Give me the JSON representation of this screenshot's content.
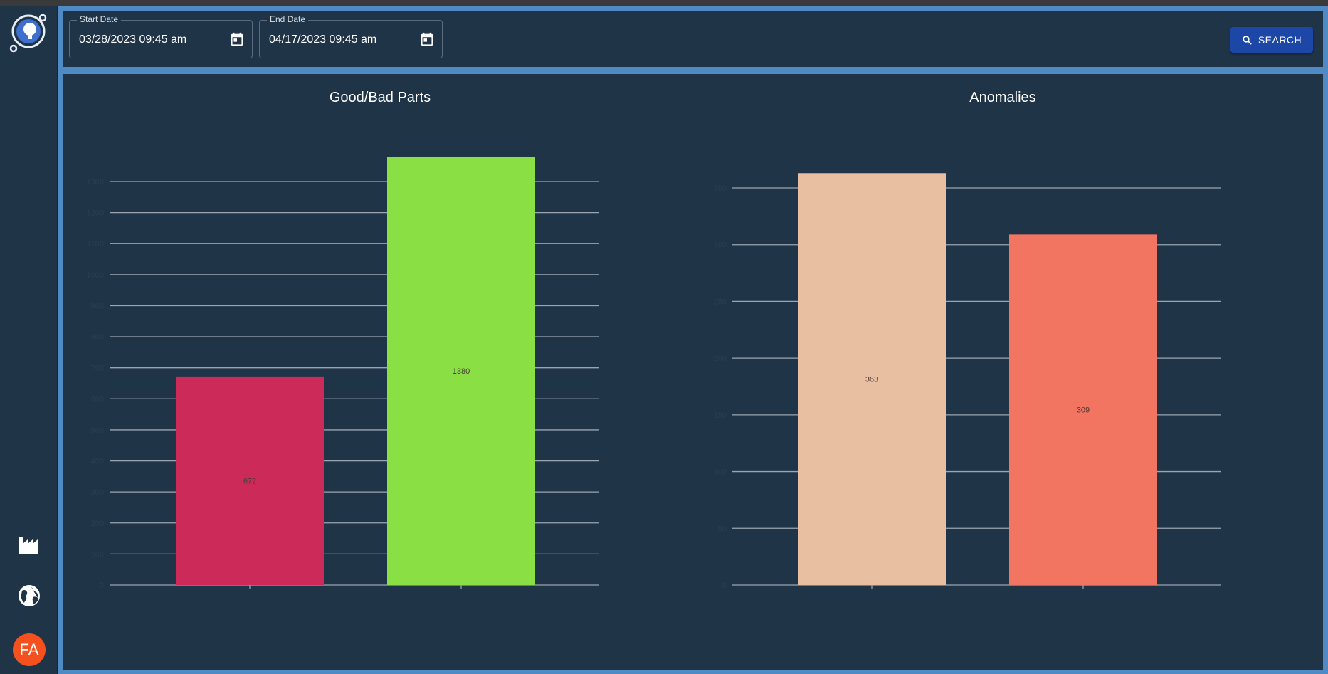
{
  "toolbar": {
    "start_date": {
      "label": "Start Date",
      "value": "03/28/2023 09:45 am"
    },
    "end_date": {
      "label": "End Date",
      "value": "04/17/2023 09:45 am"
    },
    "search_label": "SEARCH"
  },
  "sidebar": {
    "items": [
      {
        "icon": "factory-icon"
      },
      {
        "icon": "globe-icon"
      }
    ],
    "avatar_initials": "FA"
  },
  "colors": {
    "bad": "#cc2b5a",
    "good": "#8adf45",
    "anomaly_a": "#e8bfa0",
    "anomaly_b": "#f27562",
    "accent": "#1d47a7"
  },
  "chart_data": [
    {
      "type": "bar",
      "title": "Good/Bad Parts",
      "categories": [
        "",
        ""
      ],
      "values": [
        672,
        1380
      ],
      "colors": [
        "#cc2b5a",
        "#8adf45"
      ],
      "ylim": [
        0,
        1300
      ],
      "ystep": 100,
      "grid": true
    },
    {
      "type": "bar",
      "title": "Anomalies",
      "categories": [
        "",
        ""
      ],
      "values": [
        363,
        309
      ],
      "colors": [
        "#e8bfa0",
        "#f27562"
      ],
      "ylim": [
        0,
        350
      ],
      "ystep": 50,
      "grid": true
    }
  ]
}
